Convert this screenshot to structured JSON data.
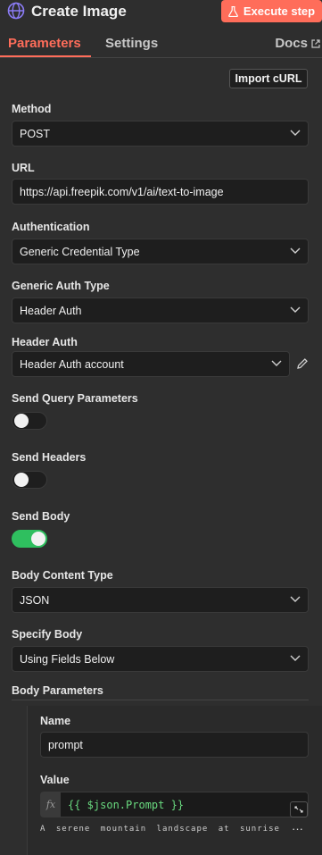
{
  "header": {
    "title": "Create Image",
    "execute_label": "Execute step",
    "execute_color": "#ff6d5a"
  },
  "tabs": {
    "parameters": "Parameters",
    "settings": "Settings",
    "docs": "Docs",
    "active": "Parameters"
  },
  "import_curl_label": "Import cURL",
  "method": {
    "label": "Method",
    "value": "POST"
  },
  "url": {
    "label": "URL",
    "value": "https://api.freepik.com/v1/ai/text-to-image"
  },
  "authentication": {
    "label": "Authentication",
    "value": "Generic Credential Type"
  },
  "generic_auth_type": {
    "label": "Generic Auth Type",
    "value": "Header Auth"
  },
  "header_auth": {
    "label": "Header Auth",
    "value": "Header Auth account"
  },
  "send_query": {
    "label": "Send Query Parameters",
    "on": false
  },
  "send_headers": {
    "label": "Send Headers",
    "on": false
  },
  "send_body": {
    "label": "Send Body",
    "on": true
  },
  "body_content_type": {
    "label": "Body Content Type",
    "value": "JSON"
  },
  "specify_body": {
    "label": "Specify Body",
    "value": "Using Fields Below"
  },
  "body_parameters": {
    "label": "Body Parameters",
    "name_label": "Name",
    "name_value": "prompt",
    "value_label": "Value",
    "value_expression": "{{ $json.Prompt }}",
    "value_preview": "A serene mountain landscape at sunrise",
    "fx_label": "fx"
  },
  "colors": {
    "accent": "#ff6d5a",
    "toggle_on": "#2fbf5f",
    "expression": "#69d97f"
  },
  "icons": [
    "globe-icon",
    "flask-icon",
    "external-link-icon",
    "chevron-down-icon",
    "pencil-icon",
    "expand-icon",
    "ellipsis-icon"
  ]
}
